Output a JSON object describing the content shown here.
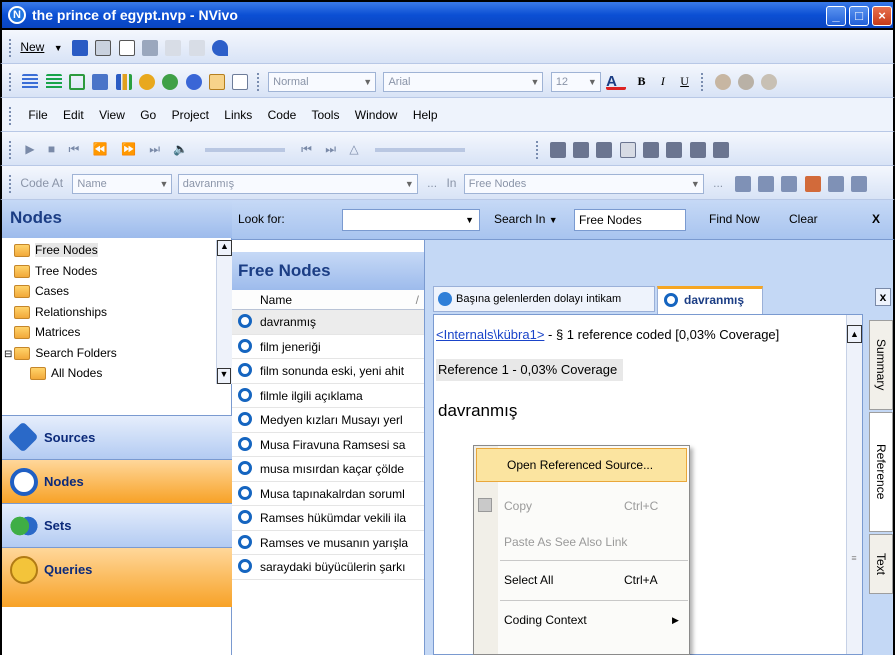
{
  "window": {
    "title": "the prince of egypt.nvp - NVivo"
  },
  "toolbar1": {
    "new_label": "New"
  },
  "format_toolbar": {
    "style": "Normal",
    "font": "Arial",
    "size": "12"
  },
  "menu": {
    "items": [
      "File",
      "Edit",
      "View",
      "Go",
      "Project",
      "Links",
      "Code",
      "Tools",
      "Window",
      "Help"
    ]
  },
  "code_bar": {
    "code_at_label": "Code At",
    "name_value": "Name",
    "code_value": "davranmış",
    "in_label": "In",
    "in_value": "Free Nodes",
    "ellipsis": "..."
  },
  "nav": {
    "header": "Nodes",
    "tree": [
      "Free Nodes",
      "Tree Nodes",
      "Cases",
      "Relationships",
      "Matrices",
      "Search Folders",
      "All Nodes"
    ],
    "buttons": [
      "Sources",
      "Nodes",
      "Sets",
      "Queries"
    ]
  },
  "find_bar": {
    "look_for_label": "Look for:",
    "look_for_value": "",
    "search_in_label": "Search In",
    "search_in_value": "Free Nodes",
    "find_now": "Find Now",
    "clear": "Clear",
    "close": "X"
  },
  "list": {
    "header": "Free Nodes",
    "column": "Name",
    "items": [
      "davranmış",
      "film jeneriği",
      "film sonunda eski, yeni ahit",
      "filmle ilgili açıklama",
      "Medyen kızları Musayı yerl",
      "Musa Firavuna Ramsesi sa",
      "musa mısırdan kaçar çölde",
      "Musa tapınakalrdan soruml",
      "Ramses hükümdar vekili ila",
      "Ramses ve musanın yarışla",
      "saraydaki büyücülerin şarkı"
    ]
  },
  "detail": {
    "tabs": [
      "Başına gelenlerden dolayı intikam",
      "davranmış"
    ],
    "close": "x",
    "link": "<Internals\\kübra1>",
    "ref_coded": " - § 1 reference coded  [0,03% Coverage]",
    "reference": "Reference 1 - 0,03% Coverage",
    "content": "davranmış",
    "side_tabs": [
      "Summary",
      "Reference",
      "Text"
    ]
  },
  "context_menu": {
    "items": [
      {
        "label": "Open Referenced Source...",
        "shortcut": ""
      },
      {
        "label": "Copy",
        "shortcut": "Ctrl+C"
      },
      {
        "label": "Paste As See Also Link",
        "shortcut": ""
      },
      {
        "label": "Select All",
        "shortcut": "Ctrl+A"
      },
      {
        "label": "Coding Context",
        "shortcut": ""
      }
    ]
  }
}
